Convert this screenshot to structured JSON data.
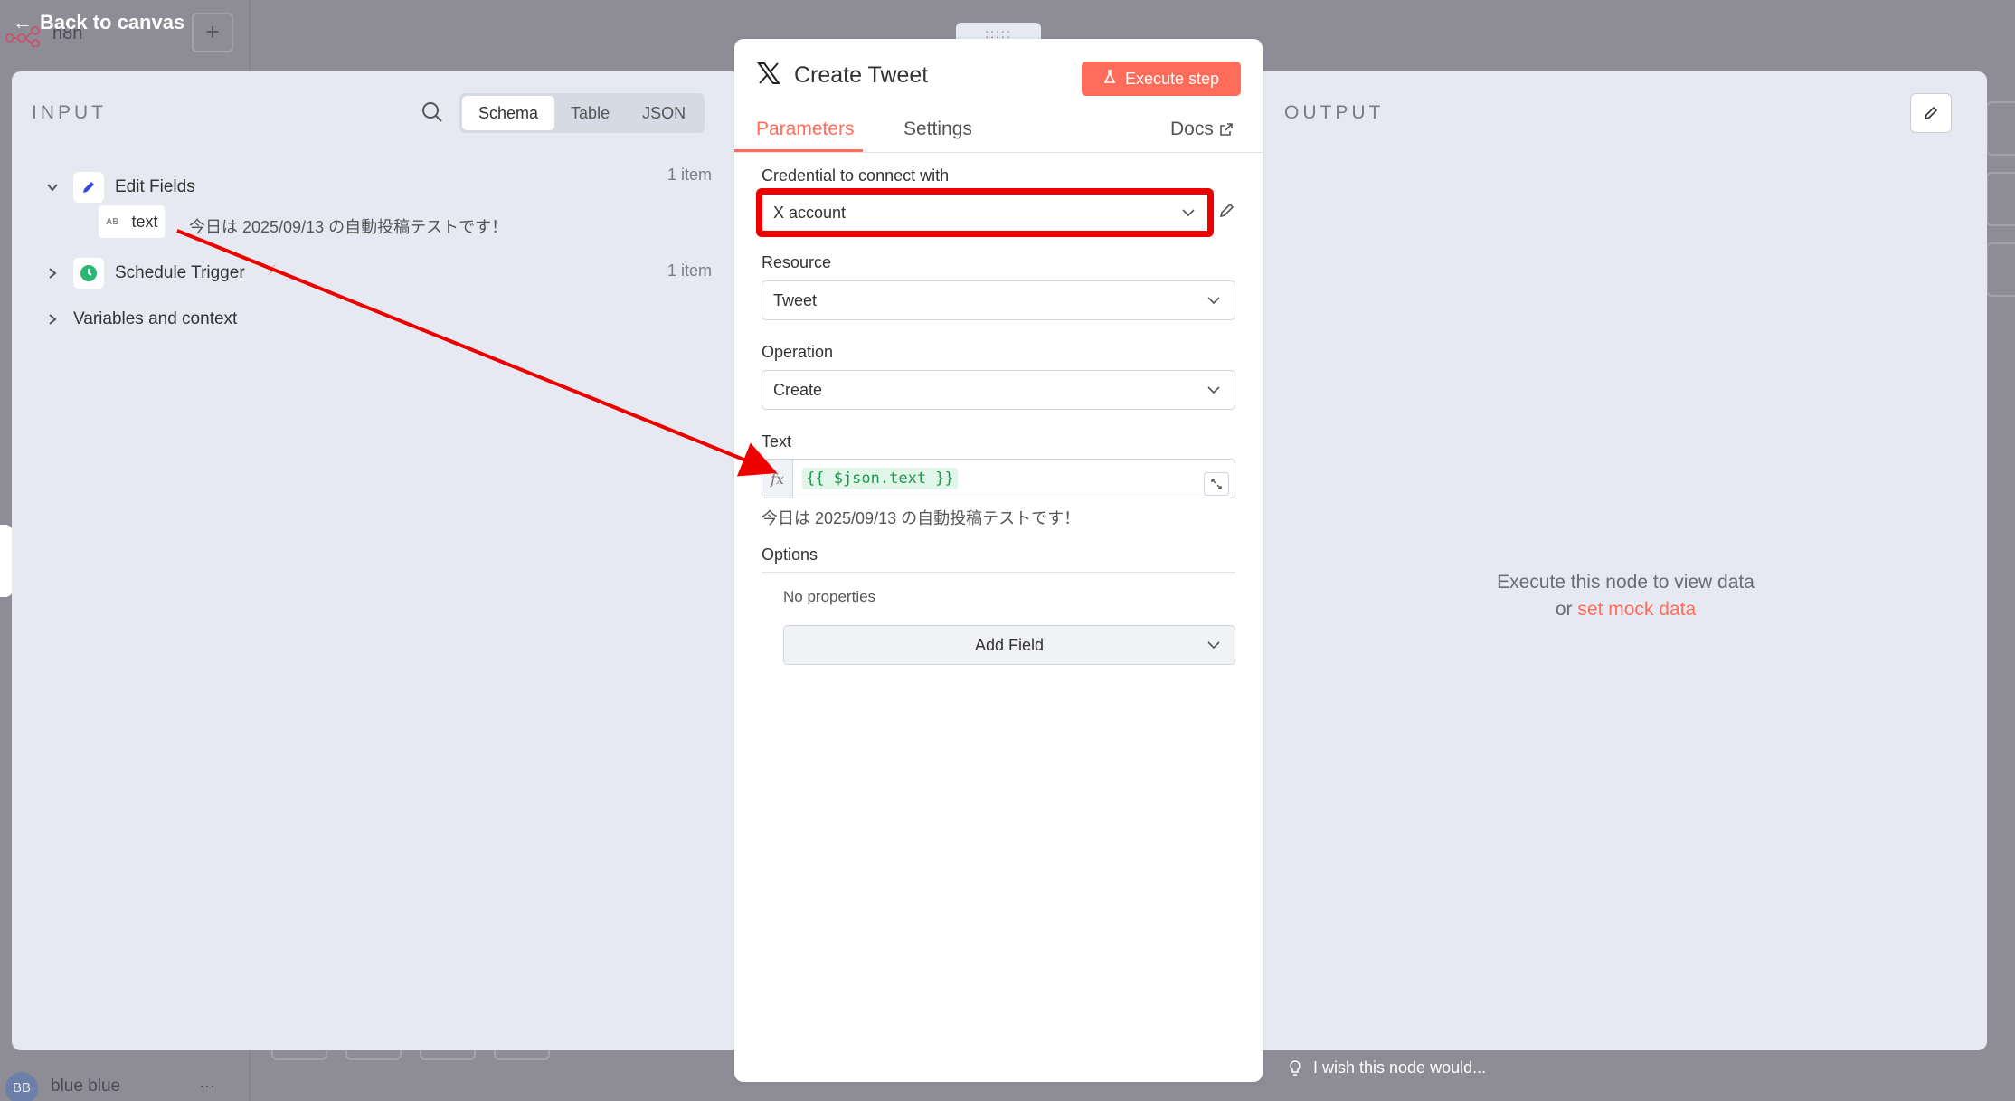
{
  "background": {
    "back_label": "Back to canvas",
    "app_name": "n8n",
    "user_initials": "BB",
    "user_name": "blue blue",
    "menu_dots": "···"
  },
  "input_panel": {
    "title": "INPUT",
    "view_modes": [
      "Schema",
      "Table",
      "JSON"
    ],
    "active_view": "Schema",
    "nodes": [
      {
        "name": "Edit Fields",
        "count": "1 item",
        "expanded": true,
        "fields": [
          {
            "type": "AB",
            "name": "text",
            "value": "今日は 2025/09/13 の自動投稿テストです！"
          }
        ]
      },
      {
        "name": "Schedule Trigger",
        "count": "1 item",
        "expanded": false
      }
    ],
    "variables_label": "Variables and context"
  },
  "node": {
    "title": "Create Tweet",
    "icon": "x-logo-icon",
    "execute_label": "Execute step",
    "tabs": [
      "Parameters",
      "Settings"
    ],
    "active_tab": "Parameters",
    "docs_label": "Docs",
    "handle": ":::::",
    "credential": {
      "label": "Credential to connect with",
      "value": "X account"
    },
    "resource": {
      "label": "Resource",
      "value": "Tweet"
    },
    "operation": {
      "label": "Operation",
      "value": "Create"
    },
    "text": {
      "label": "Text",
      "fx": "fx",
      "expression": "{{ $json.text }}",
      "preview": "今日は 2025/09/13 の自動投稿テストです！"
    },
    "options": {
      "label": "Options",
      "empty": "No properties",
      "add_label": "Add Field"
    }
  },
  "output_panel": {
    "title": "OUTPUT",
    "empty_line1": "Execute this node to view data",
    "empty_or": "or",
    "mock_link": "set mock data"
  },
  "feedback_label": "I wish this node would...",
  "colors": {
    "accent": "#ff6d5a",
    "highlight": "#ee0000",
    "expression_green": "#1a9950"
  }
}
